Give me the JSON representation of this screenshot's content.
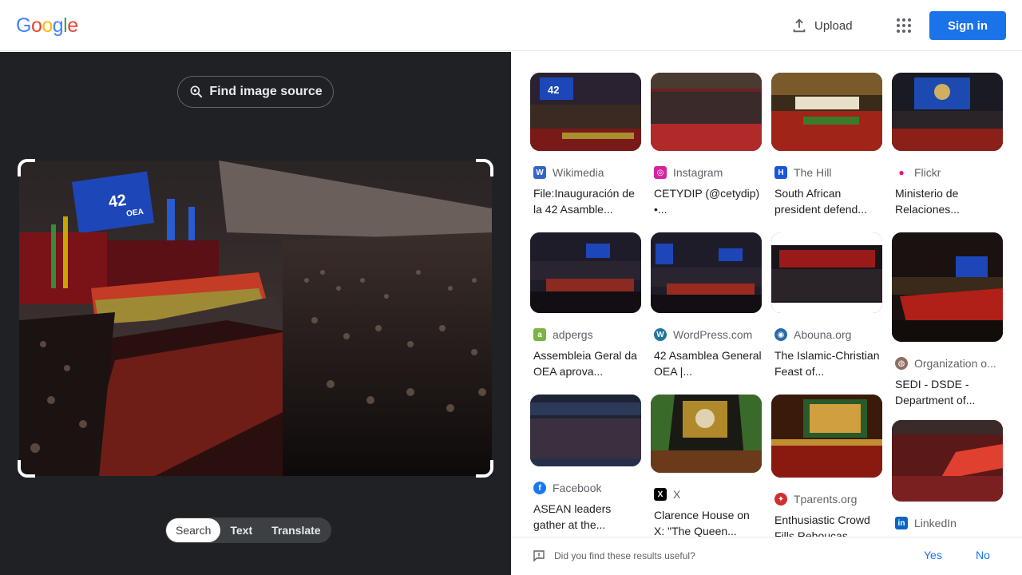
{
  "header": {
    "logo": [
      "G",
      "o",
      "o",
      "g",
      "l",
      "e"
    ],
    "upload_label": "Upload",
    "signin_label": "Sign in"
  },
  "left_pane": {
    "find_source_label": "Find image source",
    "modes": [
      "Search",
      "Text",
      "Translate"
    ],
    "active_mode": "Search"
  },
  "results": [
    {
      "source": "Wikimedia",
      "title": "File:Inauguración de la 42 Asamble...",
      "favicon": "wikimedia-icon",
      "color": "#3366cc"
    },
    {
      "source": "Instagram",
      "title": "CETYDIP (@cetydip) •...",
      "favicon": "instagram-icon",
      "color": "#d6249f"
    },
    {
      "source": "The Hill",
      "title": "South African president defend...",
      "favicon": "the-hill-icon",
      "color": "#1a56db"
    },
    {
      "source": "Flickr",
      "title": "Ministerio de Relaciones...",
      "favicon": "flickr-icon",
      "color": "#ff0084"
    },
    {
      "source": "adpergs",
      "title": "Assembleia Geral da OEA aprova...",
      "favicon": "adpergs-icon",
      "color": "#7cb342"
    },
    {
      "source": "WordPress.com",
      "title": "42 Asamblea General OEA |...",
      "favicon": "wordpress-icon",
      "color": "#21759b"
    },
    {
      "source": "Abouna.org",
      "title": "The Islamic-Christian Feast of...",
      "favicon": "abouna-icon",
      "color": "#2a6aa8"
    },
    {
      "source": "Organization o...",
      "title": "SEDI - DSDE - Department of...",
      "favicon": "oas-icon",
      "color": "#8d6e63"
    },
    {
      "source": "Facebook",
      "title": "ASEAN leaders gather at the...",
      "favicon": "facebook-icon",
      "color": "#1877f2"
    },
    {
      "source": "X",
      "title": "Clarence House on X: \"The Queen...",
      "favicon": "x-icon",
      "color": "#000000"
    },
    {
      "source": "Tparents.org",
      "title": "Enthusiastic Crowd Fills Rebouças...",
      "favicon": "tparents-icon",
      "color": "#d32f2f"
    },
    {
      "source": "LinkedIn",
      "title": "",
      "favicon": "linkedin-icon",
      "color": "#0a66c2"
    }
  ],
  "feedback": {
    "question": "Did you find these results useful?",
    "yes": "Yes",
    "no": "No"
  }
}
